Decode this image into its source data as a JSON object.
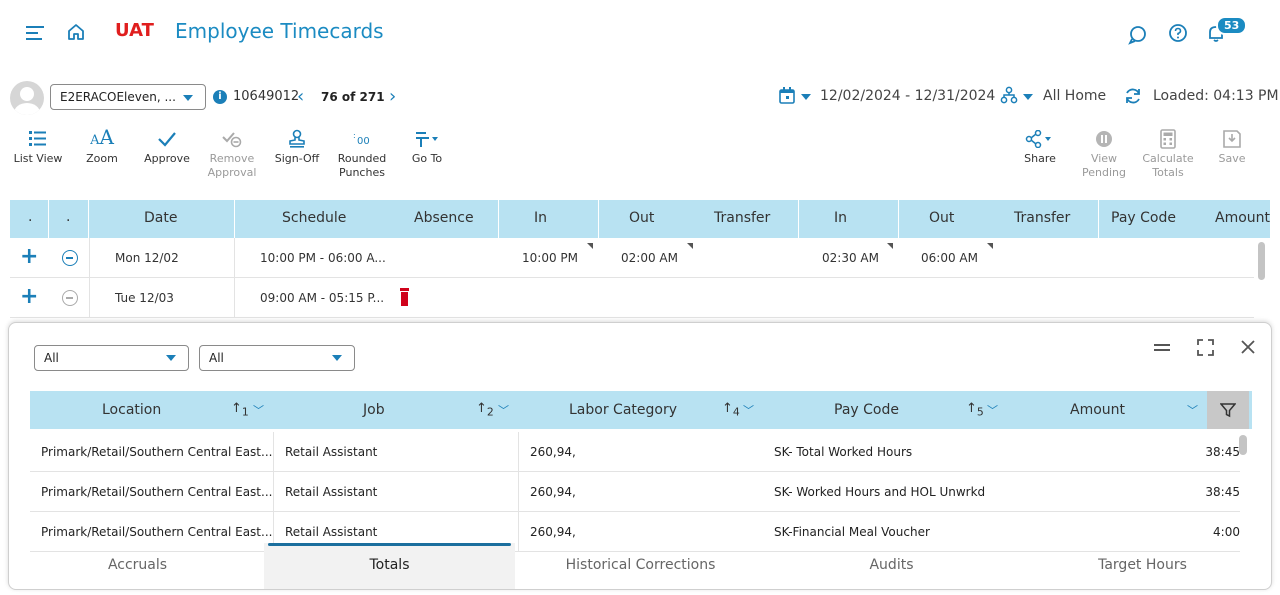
{
  "header": {
    "env_label": "UAT",
    "app_title": "Employee Timecards",
    "notifications_count": "53"
  },
  "employee_bar": {
    "employee_name": "E2ERACOEleven, ...",
    "employee_id": "10649012",
    "counter": "76 of 271",
    "date_range": "12/02/2024 - 12/31/2024",
    "location": "All Home",
    "loaded": "Loaded: 04:13 PM"
  },
  "toolbar": {
    "list_view": "List View",
    "zoom": "Zoom",
    "approve": "Approve",
    "remove_approval_1": "Remove",
    "remove_approval_2": "Approval",
    "sign_off": "Sign-Off",
    "rounded_punches_1": "Rounded",
    "rounded_punches_2": "Punches",
    "go_to": "Go To",
    "share": "Share",
    "view_pending_1": "View",
    "view_pending_2": "Pending",
    "calculate_totals_1": "Calculate",
    "calculate_totals_2": "Totals",
    "save": "Save"
  },
  "timecard": {
    "columns": {
      "dot1": ".",
      "dot2": ".",
      "date": "Date",
      "schedule": "Schedule",
      "absence": "Absence",
      "in1": "In",
      "out1": "Out",
      "transfer1": "Transfer",
      "in2": "In",
      "out2": "Out",
      "transfer2": "Transfer",
      "pay_code": "Pay Code",
      "amount": "Amount"
    },
    "rows": [
      {
        "date": "Mon 12/02",
        "schedule": "10:00 PM - 06:00 A...",
        "in1": "10:00 PM",
        "out1": "02:00 AM",
        "in2": "02:30 AM",
        "out2": "06:00 AM"
      },
      {
        "date": "Tue 12/03",
        "schedule": "09:00 AM - 05:15 P..."
      }
    ]
  },
  "totals_panel": {
    "filter1": "All",
    "filter2": "All",
    "columns": {
      "location": "Location",
      "location_sort": "1",
      "job": "Job",
      "job_sort": "2",
      "labor_category": "Labor Category",
      "labor_sort": "4",
      "pay_code": "Pay Code",
      "pay_sort": "5",
      "amount": "Amount"
    },
    "rows": [
      {
        "location": "Primark/Retail/Southern Central East...",
        "job": "Retail Assistant",
        "labor": "260,94,",
        "pay_code": "SK- Total Worked Hours",
        "amount": "38:45"
      },
      {
        "location": "Primark/Retail/Southern Central East...",
        "job": "Retail Assistant",
        "labor": "260,94,",
        "pay_code": "SK- Worked Hours and HOL Unwrkd",
        "amount": "38:45"
      },
      {
        "location": "Primark/Retail/Southern Central East...",
        "job": "Retail Assistant",
        "labor": "260,94,",
        "pay_code": "SK-Financial Meal Voucher",
        "amount": "4:00"
      }
    ],
    "tabs": [
      "Accruals",
      "Totals",
      "Historical Corrections",
      "Audits",
      "Target Hours"
    ],
    "active_tab": "Totals"
  },
  "colors": {
    "accent": "#1b7fb8",
    "env": "#e01e1e",
    "header_bg": "#b8e2f2",
    "absence_marker": "#d0021b"
  },
  "icons": [
    "menu-icon",
    "home-icon",
    "chat-icon",
    "help-icon",
    "bell-icon",
    "calendar-icon",
    "org-icon",
    "refresh-icon",
    "list-icon",
    "zoom-icon",
    "check-icon",
    "remove-approval-icon",
    "stamp-icon",
    "rounded-punches-icon",
    "goto-icon",
    "share-icon",
    "pending-icon",
    "calculator-icon",
    "save-icon",
    "collapse-icon",
    "expand-icon",
    "close-icon",
    "filter-icon"
  ]
}
